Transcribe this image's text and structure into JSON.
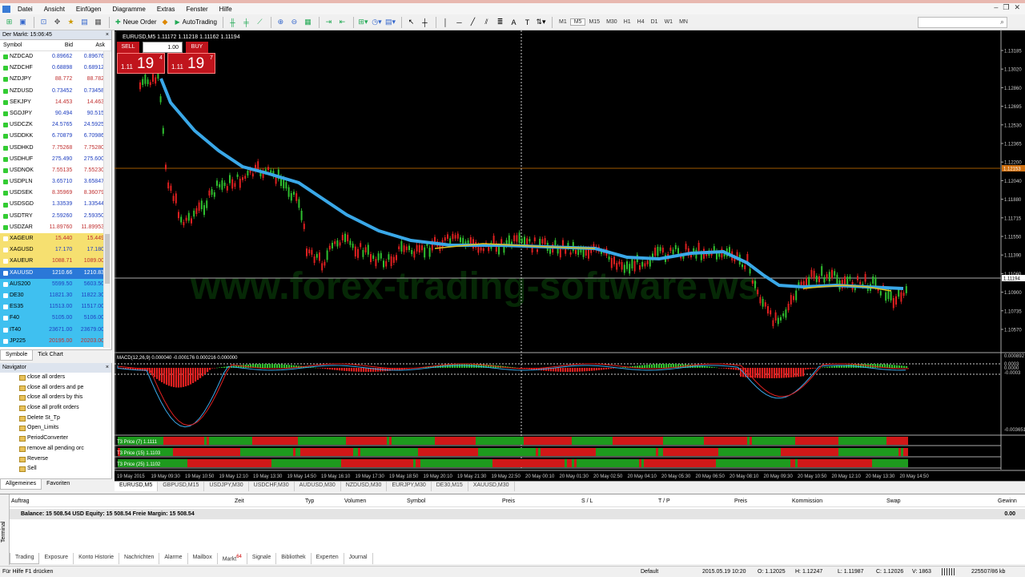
{
  "menu": [
    "Datei",
    "Ansicht",
    "Einfügen",
    "Diagramme",
    "Extras",
    "Fenster",
    "Hilfe"
  ],
  "toolbar": {
    "new_order": "Neue Order",
    "autotrading": "AutoTrading",
    "timeframes": [
      "M1",
      "M5",
      "M15",
      "M30",
      "H1",
      "H4",
      "D1",
      "W1",
      "MN"
    ]
  },
  "market_watch": {
    "title": "Der Markt: 15:06:45",
    "headers": {
      "symbol": "Symbol",
      "bid": "Bid",
      "ask": "Ask"
    },
    "rows": [
      {
        "symbol": "NZDCAD",
        "bid": "0.89662",
        "ask": "0.89676",
        "color": "#2040c0"
      },
      {
        "symbol": "NZDCHF",
        "bid": "0.68898",
        "ask": "0.68912",
        "color": "#2040c0"
      },
      {
        "symbol": "NZDJPY",
        "bid": "88.772",
        "ask": "88.782",
        "color": "#c03030"
      },
      {
        "symbol": "NZDUSD",
        "bid": "0.73452",
        "ask": "0.73458",
        "color": "#2040c0"
      },
      {
        "symbol": "SEKJPY",
        "bid": "14.453",
        "ask": "14.463",
        "color": "#c03030"
      },
      {
        "symbol": "SGDJPY",
        "bid": "90.494",
        "ask": "90.515",
        "color": "#2040c0"
      },
      {
        "symbol": "USDCZK",
        "bid": "24.5765",
        "ask": "24.5925",
        "color": "#2040c0"
      },
      {
        "symbol": "USDDKK",
        "bid": "6.70879",
        "ask": "6.70986",
        "color": "#2040c0"
      },
      {
        "symbol": "USDHKD",
        "bid": "7.75268",
        "ask": "7.75280",
        "color": "#c03030"
      },
      {
        "symbol": "USDHUF",
        "bid": "275.490",
        "ask": "275.600",
        "color": "#2040c0"
      },
      {
        "symbol": "USDNOK",
        "bid": "7.55135",
        "ask": "7.55230",
        "color": "#c03030"
      },
      {
        "symbol": "USDPLN",
        "bid": "3.65710",
        "ask": "3.65847",
        "color": "#2040c0"
      },
      {
        "symbol": "USDSEK",
        "bid": "8.35969",
        "ask": "8.36079",
        "color": "#c03030"
      },
      {
        "symbol": "USDSGD",
        "bid": "1.33539",
        "ask": "1.33544",
        "color": "#2040c0"
      },
      {
        "symbol": "USDTRY",
        "bid": "2.59260",
        "ask": "2.59350",
        "color": "#2040c0"
      },
      {
        "symbol": "USDZAR",
        "bid": "11.89760",
        "ask": "11.89953",
        "color": "#c03030"
      },
      {
        "symbol": "XAGEUR",
        "bid": "15.440",
        "ask": "15.449",
        "color": "#c03030",
        "bg": "#f6e070"
      },
      {
        "symbol": "XAGUSD",
        "bid": "17.170",
        "ask": "17.180",
        "color": "#2040c0",
        "bg": "#f6e070"
      },
      {
        "symbol": "XAUEUR",
        "bid": "1088.71",
        "ask": "1089.00",
        "color": "#c03030",
        "bg": "#f6e070"
      },
      {
        "symbol": "XAUUSD",
        "bid": "1210.66",
        "ask": "1210.83",
        "color": "#ffffff",
        "bg": "#2a78d8",
        "selected": true
      },
      {
        "symbol": "AUS200",
        "bid": "5599.50",
        "ask": "5603.50",
        "color": "#2040c0",
        "bg": "#3fc0f0"
      },
      {
        "symbol": "DE30",
        "bid": "11821.30",
        "ask": "11822.30",
        "color": "#2040c0",
        "bg": "#3fc0f0"
      },
      {
        "symbol": "ES35",
        "bid": "11513.00",
        "ask": "11517.00",
        "color": "#2040c0",
        "bg": "#3fc0f0"
      },
      {
        "symbol": "F40",
        "bid": "5105.00",
        "ask": "5106.00",
        "color": "#2040c0",
        "bg": "#3fc0f0"
      },
      {
        "symbol": "IT40",
        "bid": "23671.00",
        "ask": "23679.00",
        "color": "#2040c0",
        "bg": "#3fc0f0"
      },
      {
        "symbol": "JP225",
        "bid": "20195.00",
        "ask": "20203.00",
        "color": "#c03030",
        "bg": "#3fc0f0"
      }
    ],
    "tabs": [
      "Symbole",
      "Tick Chart"
    ]
  },
  "navigator": {
    "title": "Navigator",
    "items": [
      "close all orders",
      "close all orders and pe",
      "close all orders by this",
      "close all profit orders",
      "Delete St_Tp",
      "Open_Limits",
      "PeriodConverter",
      "remove all pending orc",
      "Reverse",
      "Sell"
    ],
    "tabs": [
      "Allgemeines",
      "Favoriten"
    ]
  },
  "chart": {
    "header": "EURUSD,M5  1.11172 1.11218 1.11162 1.11194",
    "watermark": "www.forex-trading-software.ws",
    "trade_panel": {
      "sell": "SELL",
      "buy": "BUY",
      "lot": "1.00",
      "sell_small": "1.11",
      "sell_big": "19",
      "sell_pip": "4",
      "buy_small": "1.11",
      "buy_big": "19",
      "buy_pip": "7"
    },
    "price_labels": [
      "1.13185",
      "1.13020",
      "1.12860",
      "1.12695",
      "1.12530",
      "1.12365",
      "1.12200",
      "1.12040",
      "1.11880",
      "1.11715",
      "1.11550",
      "1.11390",
      "1.11060",
      "1.10900",
      "1.10735",
      "1.10570"
    ],
    "current_price": "1.11194",
    "hline_price": "1.12153",
    "macd_header": "MACD(12,26,9) 0.000040 -0.000176 0.000216 0.000000",
    "macd_labels": [
      "0.000892",
      "0.0003",
      "0.0000",
      "-0.0003",
      "-0.003651"
    ],
    "t3_labels": [
      "T3 Price (7) 1.1111",
      "T3 Price (15) 1.1103",
      "T3 Price (25) 1.1102"
    ],
    "time_labels": [
      "19 May 2015",
      "19 May 09:30",
      "19 May 10:50",
      "19 May 12:10",
      "19 May 13:30",
      "19 May 14:50",
      "19 May 16:10",
      "19 May 17:30",
      "19 May 18:50",
      "19 May 20:10",
      "19 May 21:30",
      "19 May 22:50",
      "20 May 00:10",
      "20 May 01:30",
      "20 May 02:50",
      "20 May 04:10",
      "20 May 05:30",
      "20 May 06:50",
      "20 May 08:10",
      "20 May 09:30",
      "20 May 10:50",
      "20 May 12:10",
      "20 May 13:30",
      "20 May 14:50"
    ]
  },
  "chart_tabs": [
    "EURUSD,M5",
    "GBPUSD,M15",
    "USDJPY,M30",
    "USDCHF,M30",
    "AUDUSD,M30",
    "NZDUSD,M30",
    "EURJPY,M30",
    "DE30,M15",
    "XAUUSD,M30"
  ],
  "terminal": {
    "side_label": "Terminal",
    "headers": [
      "Auftrag",
      "Zeit",
      "Typ",
      "Volumen",
      "Symbol",
      "Preis",
      "S / L",
      "T / P",
      "Preis",
      "Kommission",
      "Swap",
      "Gewinn"
    ],
    "balance": "Balance: 15 508.54 USD  Equity: 15 508.54  Freie Margin: 15 508.54",
    "balance_value": "0.00",
    "tabs": [
      "Trading",
      "Exposure",
      "Konto Historie",
      "Nachrichten",
      "Alarme",
      "Mailbox",
      "Markt",
      "Signale",
      "Bibliothek",
      "Experten",
      "Journal"
    ],
    "markt_badge": "64"
  },
  "status": {
    "help": "Für Hilfe F1 drücken",
    "profile": "Default",
    "datetime": "2015.05.19 10:20",
    "open": "O: 1.12025",
    "high": "H: 1.12247",
    "low": "L: 1.11987",
    "close": "C: 1.12026",
    "volume": "V: 1863",
    "traffic": "225507/86 kb"
  }
}
